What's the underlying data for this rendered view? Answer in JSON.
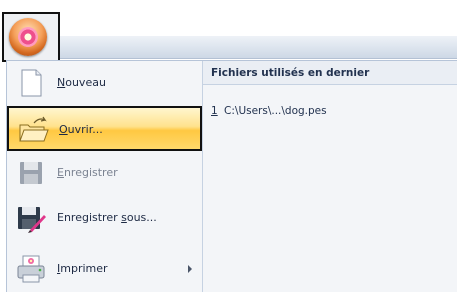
{
  "app": {
    "button_icon": "app-orb-flower-icon"
  },
  "menu": {
    "items": [
      {
        "label_prefix": "",
        "label_mnemonic": "N",
        "label_rest": "ouveau",
        "icon": "new-document-icon",
        "state": "normal"
      },
      {
        "label_prefix": "",
        "label_mnemonic": "O",
        "label_rest": "uvrir...",
        "icon": "open-folder-icon",
        "state": "selected"
      },
      {
        "label_prefix": "",
        "label_mnemonic": "E",
        "label_rest": "nregistrer",
        "icon": "save-disk-icon",
        "state": "disabled"
      },
      {
        "label_prefix": "Enregistrer ",
        "label_mnemonic": "s",
        "label_rest": "ous...",
        "icon": "save-as-icon",
        "state": "normal"
      },
      {
        "label_prefix": "",
        "label_mnemonic": "I",
        "label_rest": "mprimer",
        "icon": "print-icon",
        "state": "normal",
        "has_submenu": true
      }
    ]
  },
  "recent": {
    "header": "Fichiers utilisés en dernier",
    "items": [
      {
        "index": "1",
        "path": "C:\\Users\\...\\dog.pes"
      }
    ]
  },
  "colors": {
    "selected_highlight": "#ffd04a",
    "panel_bg": "#f3f5f8",
    "ribbon_bg": "#cdd8e6",
    "text": "#1e2a44"
  }
}
